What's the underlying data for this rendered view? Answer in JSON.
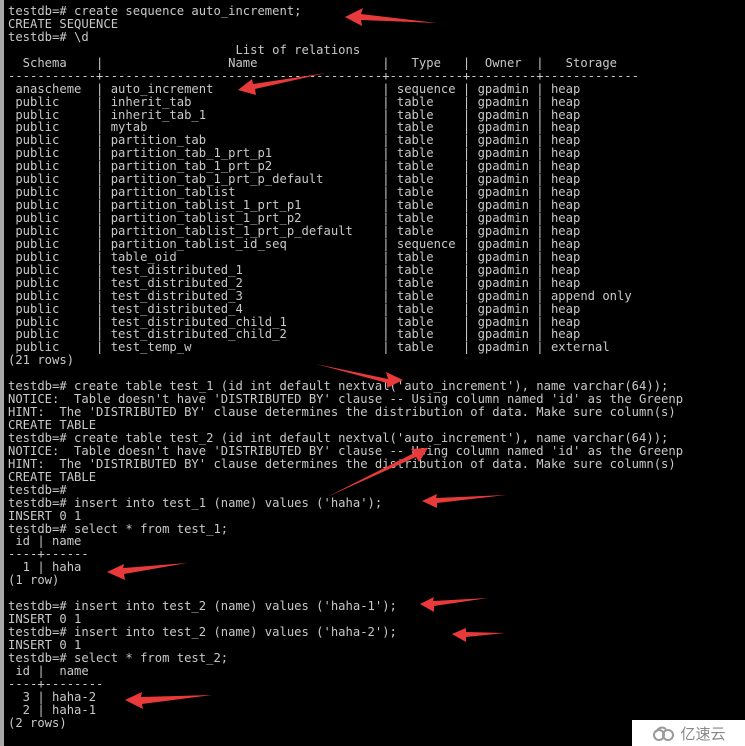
{
  "terminal": {
    "lines": [
      "testdb=# create sequence auto_increment;",
      "CREATE SEQUENCE",
      "testdb=# \\d",
      "                               List of relations",
      "  Schema    |                 Name                 |   Type   |  Owner  |   Storage",
      "------------+--------------------------------------+----------+---------+-------------",
      " anascheme  | auto_increment                       | sequence | gpadmin | heap",
      " public     | inherit_tab                          | table    | gpadmin | heap",
      " public     | inherit_tab_1                        | table    | gpadmin | heap",
      " public     | mytab                                | table    | gpadmin | heap",
      " public     | partition_tab                        | table    | gpadmin | heap",
      " public     | partition_tab_1_prt_p1               | table    | gpadmin | heap",
      " public     | partition_tab_1_prt_p2               | table    | gpadmin | heap",
      " public     | partition_tab_1_prt_p_default        | table    | gpadmin | heap",
      " public     | partition_tablist                    | table    | gpadmin | heap",
      " public     | partition_tablist_1_prt_p1           | table    | gpadmin | heap",
      " public     | partition_tablist_1_prt_p2           | table    | gpadmin | heap",
      " public     | partition_tablist_1_prt_p_default    | table    | gpadmin | heap",
      " public     | partition_tablist_id_seq             | sequence | gpadmin | heap",
      " public     | table_oid                            | table    | gpadmin | heap",
      " public     | test_distributed_1                   | table    | gpadmin | heap",
      " public     | test_distributed_2                   | table    | gpadmin | heap",
      " public     | test_distributed_3                   | table    | gpadmin | append only",
      " public     | test_distributed_4                   | table    | gpadmin | heap",
      " public     | test_distributed_child_1             | table    | gpadmin | heap",
      " public     | test_distributed_child_2             | table    | gpadmin | heap",
      " public     | test_temp_w                          | table    | gpadmin | external",
      "(21 rows)",
      "",
      "testdb=# create table test_1 (id int default nextval('auto_increment'), name varchar(64));",
      "NOTICE:  Table doesn't have 'DISTRIBUTED BY' clause -- Using column named 'id' as the Greenp",
      "HINT:  The 'DISTRIBUTED BY' clause determines the distribution of data. Make sure column(s)",
      "CREATE TABLE",
      "testdb=# create table test_2 (id int default nextval('auto_increment'), name varchar(64));",
      "NOTICE:  Table doesn't have 'DISTRIBUTED BY' clause -- Using column named 'id' as the Greenp",
      "HINT:  The 'DISTRIBUTED BY' clause determines the distribution of data. Make sure column(s)",
      "CREATE TABLE",
      "testdb=#",
      "testdb=# insert into test_1 (name) values ('haha');",
      "INSERT 0 1",
      "testdb=# select * from test_1;",
      " id | name",
      "----+------",
      "  1 | haha",
      "(1 row)",
      "",
      "testdb=# insert into test_2 (name) values ('haha-1');",
      "INSERT 0 1",
      "testdb=# insert into test_2 (name) values ('haha-2');",
      "INSERT 0 1",
      "testdb=# select * from test_2;",
      " id |  name",
      "----+--------",
      "  3 | haha-2",
      "  2 | haha-1",
      "(2 rows)"
    ]
  },
  "annotations": {
    "arrow_color": "#e83a3a",
    "arrow_count": 9
  },
  "watermark": {
    "text": "亿速云",
    "icon": "cloud-logo-icon"
  }
}
